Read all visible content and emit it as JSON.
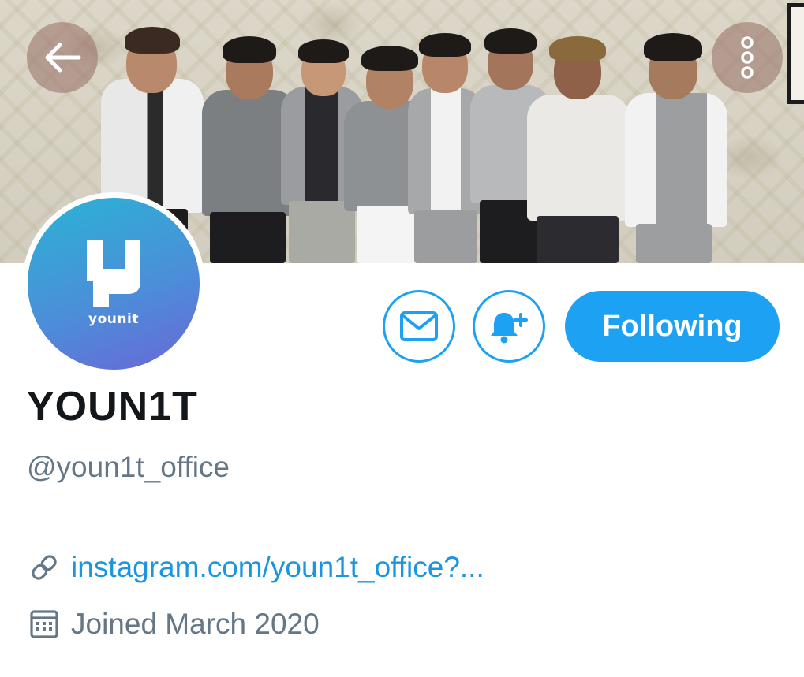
{
  "header": {
    "back_icon": "arrow-left-icon",
    "more_icon": "more-vertical-icon"
  },
  "avatar": {
    "letter": "y",
    "wordmark": "younit",
    "gradient": [
      "#2ab3d4",
      "#4b8fd9",
      "#6a67d8"
    ]
  },
  "actions": {
    "message_icon": "envelope-icon",
    "notify_icon": "bell-plus-icon",
    "follow_label": "Following"
  },
  "profile": {
    "display_name": "YOUN1T",
    "handle": "@youn1t_office",
    "website": "instagram.com/youn1t_office?...",
    "joined": "Joined March 2020"
  },
  "colors": {
    "accent": "#1da1f2",
    "link": "#1b95e0",
    "secondary_text": "#657786",
    "primary_text": "#14171a"
  }
}
